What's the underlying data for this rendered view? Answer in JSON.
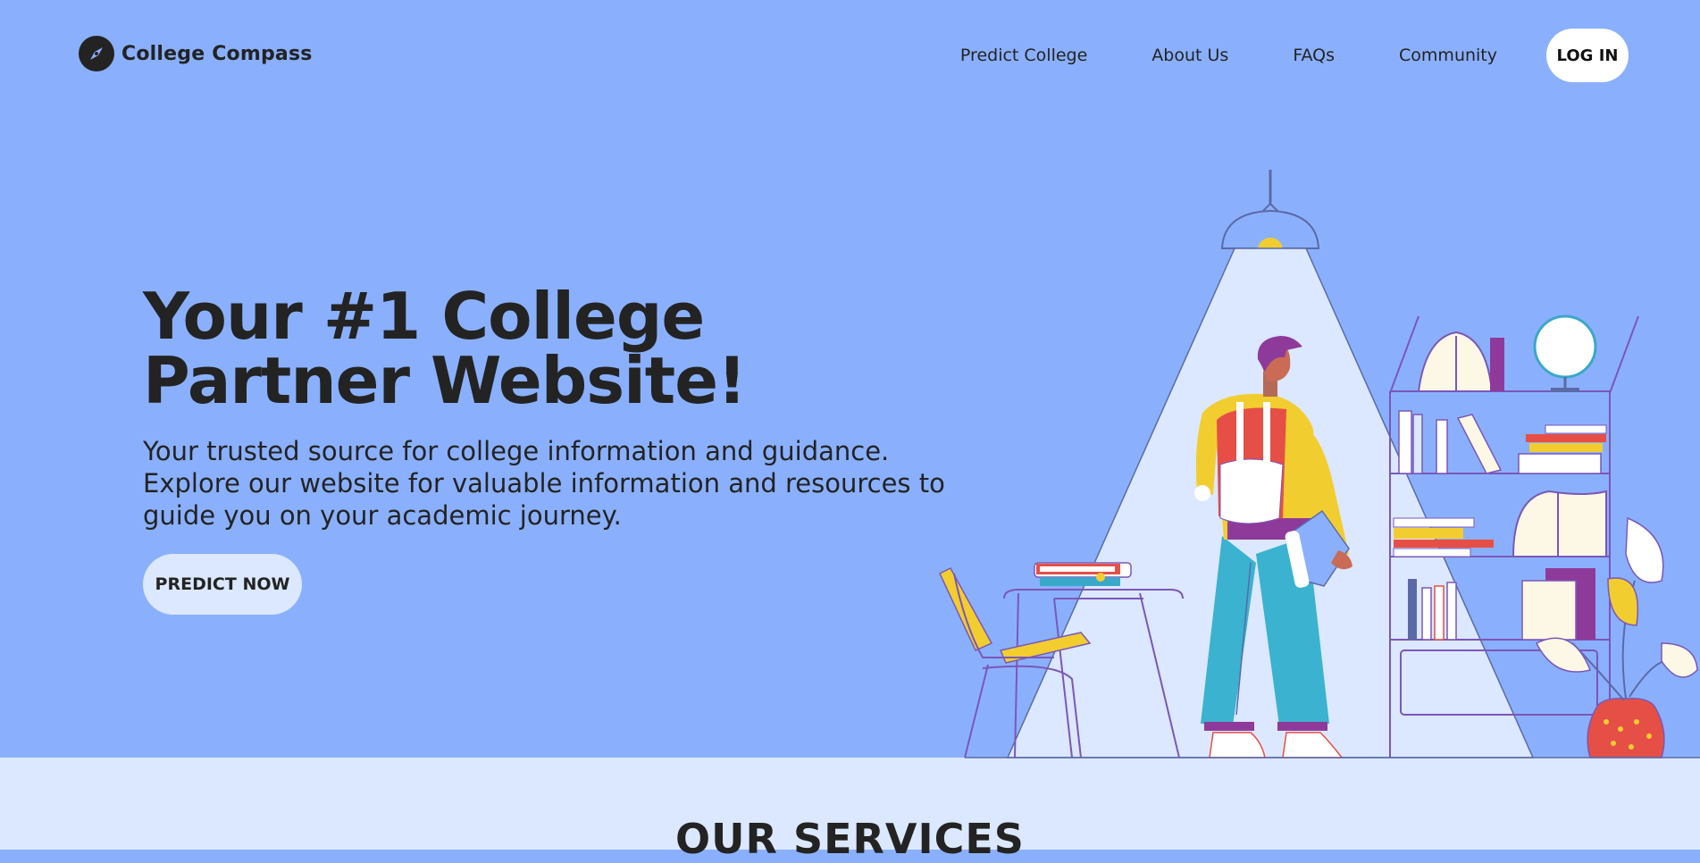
{
  "brand": {
    "name": "College Compass",
    "icon": "compass-icon"
  },
  "nav": {
    "links": [
      "Predict College",
      "About Us",
      "FAQs",
      "Community"
    ],
    "login_label": "LOG IN"
  },
  "hero": {
    "headline": "Your #1 College Partner Website!",
    "subtext": "Your trusted source for college information and guidance. Explore our website for valuable information and resources to guide you on your academic journey.",
    "cta_label": "PREDICT NOW"
  },
  "services": {
    "title": "OUR SERVICES"
  },
  "colors": {
    "hero_bg": "#8ab0fd",
    "section_bg": "#dbe8ff",
    "text": "#232323",
    "button_light": "#dbe8ff",
    "login_bg": "#ffffff"
  }
}
